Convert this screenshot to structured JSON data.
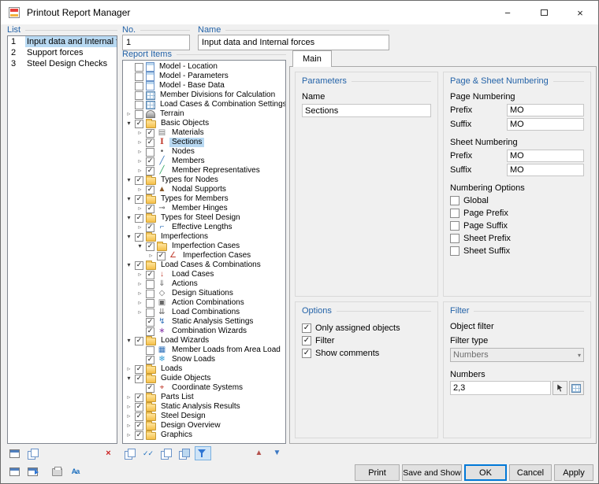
{
  "window": {
    "title": "Printout Report Manager",
    "minimize_glyph": "−",
    "close_glyph": "×"
  },
  "left": {
    "list_label": "List",
    "items": [
      {
        "no": "1",
        "label": "Input data and Internal forces",
        "selected": true
      },
      {
        "no": "2",
        "label": "Support forces",
        "selected": false
      },
      {
        "no": "3",
        "label": "Steel Design Checks",
        "selected": false
      }
    ]
  },
  "fields": {
    "no_label": "No.",
    "no_value": "1",
    "name_label": "Name",
    "name_value": "Input data and Internal forces"
  },
  "tree": {
    "label": "Report Items",
    "items": [
      {
        "lvl": 0,
        "arrow": "",
        "chk": false,
        "icon": "model",
        "label": "Model - Location",
        "sel": false
      },
      {
        "lvl": 0,
        "arrow": "",
        "chk": false,
        "icon": "model",
        "label": "Model - Parameters",
        "sel": false
      },
      {
        "lvl": 0,
        "arrow": "",
        "chk": false,
        "icon": "model",
        "label": "Model - Base Data",
        "sel": false
      },
      {
        "lvl": 0,
        "arrow": "",
        "chk": false,
        "icon": "grid",
        "label": "Member Divisions for Calculation",
        "sel": false
      },
      {
        "lvl": 0,
        "arrow": "",
        "chk": false,
        "icon": "grid",
        "label": "Load Cases & Combination Settings",
        "sel": false
      },
      {
        "lvl": 0,
        "arrow": "c",
        "chk": false,
        "icon": "terrain",
        "label": "Terrain",
        "sel": false
      },
      {
        "lvl": 0,
        "arrow": "e",
        "chk": true,
        "icon": "folder",
        "label": "Basic Objects",
        "sel": false
      },
      {
        "lvl": 1,
        "arrow": "c",
        "chk": true,
        "icon": "materials",
        "label": "Materials",
        "sel": false
      },
      {
        "lvl": 1,
        "arrow": "c",
        "chk": true,
        "icon": "sections",
        "label": "Sections",
        "sel": true
      },
      {
        "lvl": 1,
        "arrow": "c",
        "chk": false,
        "icon": "nodes",
        "label": "Nodes",
        "sel": false
      },
      {
        "lvl": 1,
        "arrow": "c",
        "chk": true,
        "icon": "members",
        "label": "Members",
        "sel": false
      },
      {
        "lvl": 1,
        "arrow": "c",
        "chk": true,
        "icon": "member-representatives",
        "label": "Member Representatives",
        "sel": false
      },
      {
        "lvl": 0,
        "arrow": "e",
        "chk": true,
        "icon": "folder",
        "label": "Types for Nodes",
        "sel": false
      },
      {
        "lvl": 1,
        "arrow": "c",
        "chk": true,
        "icon": "nodal-supports",
        "label": "Nodal Supports",
        "sel": false
      },
      {
        "lvl": 0,
        "arrow": "e",
        "chk": true,
        "icon": "folder",
        "label": "Types for Members",
        "sel": false
      },
      {
        "lvl": 1,
        "arrow": "c",
        "chk": true,
        "icon": "member-hinges",
        "label": "Member Hinges",
        "sel": false
      },
      {
        "lvl": 0,
        "arrow": "e",
        "chk": true,
        "icon": "folder",
        "label": "Types for Steel Design",
        "sel": false
      },
      {
        "lvl": 1,
        "arrow": "c",
        "chk": true,
        "icon": "effective-lengths",
        "label": "Effective Lengths",
        "sel": false
      },
      {
        "lvl": 0,
        "arrow": "e",
        "chk": true,
        "icon": "folder",
        "label": "Imperfections",
        "sel": false
      },
      {
        "lvl": 1,
        "arrow": "e",
        "chk": true,
        "icon": "folder",
        "label": "Imperfection Cases",
        "sel": false
      },
      {
        "lvl": 2,
        "arrow": "c",
        "chk": true,
        "icon": "imperfection-case",
        "label": "Imperfection Cases",
        "sel": false
      },
      {
        "lvl": 0,
        "arrow": "e",
        "chk": true,
        "icon": "folder",
        "label": "Load Cases & Combinations",
        "sel": false
      },
      {
        "lvl": 1,
        "arrow": "c",
        "chk": true,
        "icon": "load-cases",
        "label": "Load Cases",
        "sel": false
      },
      {
        "lvl": 1,
        "arrow": "c",
        "chk": false,
        "icon": "actions",
        "label": "Actions",
        "sel": false
      },
      {
        "lvl": 1,
        "arrow": "c",
        "chk": false,
        "icon": "design-situations",
        "label": "Design Situations",
        "sel": false
      },
      {
        "lvl": 1,
        "arrow": "c",
        "chk": false,
        "icon": "action-combinations",
        "label": "Action Combinations",
        "sel": false
      },
      {
        "lvl": 1,
        "arrow": "c",
        "chk": false,
        "icon": "load-combinations",
        "label": "Load Combinations",
        "sel": false
      },
      {
        "lvl": 1,
        "arrow": "",
        "chk": true,
        "icon": "static-analysis-settings",
        "label": "Static Analysis Settings",
        "sel": false
      },
      {
        "lvl": 1,
        "arrow": "",
        "chk": true,
        "icon": "combination-wizards",
        "label": "Combination Wizards",
        "sel": false
      },
      {
        "lvl": 0,
        "arrow": "e",
        "chk": true,
        "icon": "folder",
        "label": "Load Wizards",
        "sel": false
      },
      {
        "lvl": 1,
        "arrow": "",
        "chk": false,
        "icon": "area-load",
        "label": "Member Loads from Area Load",
        "sel": false
      },
      {
        "lvl": 1,
        "arrow": "",
        "chk": true,
        "icon": "snow-loads",
        "label": "Snow Loads",
        "sel": false
      },
      {
        "lvl": 0,
        "arrow": "c",
        "chk": true,
        "icon": "folder",
        "label": "Loads",
        "sel": false
      },
      {
        "lvl": 0,
        "arrow": "e",
        "chk": true,
        "icon": "folder",
        "label": "Guide Objects",
        "sel": false
      },
      {
        "lvl": 1,
        "arrow": "",
        "chk": true,
        "icon": "coordinate-systems",
        "label": "Coordinate Systems",
        "sel": false
      },
      {
        "lvl": 0,
        "arrow": "c",
        "chk": true,
        "icon": "folder",
        "label": "Parts List",
        "sel": false
      },
      {
        "lvl": 0,
        "arrow": "c",
        "chk": true,
        "icon": "folder",
        "label": "Static Analysis Results",
        "sel": false
      },
      {
        "lvl": 0,
        "arrow": "c",
        "chk": true,
        "icon": "folder",
        "label": "Steel Design",
        "sel": false
      },
      {
        "lvl": 0,
        "arrow": "c",
        "chk": true,
        "icon": "folder",
        "label": "Design Overview",
        "sel": false
      },
      {
        "lvl": 0,
        "arrow": "c",
        "chk": true,
        "icon": "folder",
        "label": "Graphics",
        "sel": false
      }
    ]
  },
  "tabs": {
    "main_label": "Main"
  },
  "parameters": {
    "title": "Parameters",
    "name_label": "Name",
    "name_value": "Sections"
  },
  "numbering": {
    "title": "Page & Sheet Numbering",
    "page_label": "Page Numbering",
    "sheet_label": "Sheet Numbering",
    "prefix_label": "Prefix",
    "suffix_label": "Suffix",
    "page_prefix": "MO",
    "page_suffix": "MO",
    "sheet_prefix": "MO",
    "sheet_suffix": "MO",
    "options_label": "Numbering Options",
    "options": [
      {
        "label": "Global",
        "checked": false
      },
      {
        "label": "Page Prefix",
        "checked": false
      },
      {
        "label": "Page Suffix",
        "checked": false
      },
      {
        "label": "Sheet Prefix",
        "checked": false
      },
      {
        "label": "Sheet Suffix",
        "checked": false
      }
    ]
  },
  "options": {
    "title": "Options",
    "items": [
      {
        "label": "Only assigned objects",
        "checked": true
      },
      {
        "label": "Filter",
        "checked": true
      },
      {
        "label": "Show comments",
        "checked": true
      }
    ]
  },
  "filter": {
    "title": "Filter",
    "object_filter_label": "Object filter",
    "type_label": "Filter type",
    "type_value": "Numbers",
    "numbers_label": "Numbers",
    "numbers_value": "2,3"
  },
  "footer": {
    "print": "Print",
    "save_and_show": "Save and Show",
    "ok": "OK",
    "cancel": "Cancel",
    "apply": "Apply"
  },
  "toolbars": {
    "list": [
      {
        "name": "new-report",
        "icon": "win"
      },
      {
        "name": "copy-report",
        "icon": "docs"
      },
      {
        "name": "delete-report",
        "icon": "delete-x"
      }
    ],
    "tree": [
      {
        "name": "cascade-items",
        "icon": "docs"
      },
      {
        "name": "check-subitems",
        "icon": "double-check"
      },
      {
        "name": "copy-item",
        "icon": "docs"
      },
      {
        "name": "paste-item",
        "icon": "docs-blue"
      },
      {
        "name": "filter-display",
        "icon": "funnel",
        "pressed": true
      },
      {
        "name": "move-up",
        "icon": "arrow-up"
      },
      {
        "name": "move-down",
        "icon": "arrow-down"
      }
    ],
    "footer": [
      {
        "name": "report-header-settings",
        "icon": "win"
      },
      {
        "name": "open-report-viewer",
        "icon": "win-arrow"
      },
      {
        "name": "printer-setup",
        "icon": "printer"
      },
      {
        "name": "language-settings",
        "icon": "fonts"
      }
    ]
  },
  "icons": {
    "model": {
      "css": "doc"
    },
    "grid": {
      "css": "grid"
    },
    "terrain": {
      "css": "terrain"
    },
    "folder": {
      "css": "folder"
    },
    "materials": {
      "glyph": "▤",
      "color": "#7d7d7d"
    },
    "sections": {
      "glyph": "I",
      "color": "#c03a2b",
      "serif": true
    },
    "nodes": {
      "glyph": "•",
      "color": "#555555"
    },
    "members": {
      "glyph": "╱",
      "color": "#2e6fb8"
    },
    "member-representatives": {
      "glyph": "╱",
      "color": "#27a05d"
    },
    "nodal-supports": {
      "glyph": "▲",
      "color": "#8b5a2b"
    },
    "member-hinges": {
      "glyph": "⊸",
      "color": "#555555"
    },
    "effective-lengths": {
      "glyph": "⌐",
      "color": "#2e6fb8"
    },
    "imperfection-case": {
      "glyph": "∠",
      "color": "#c03a2b"
    },
    "load-cases": {
      "glyph": "↓",
      "color": "#c03a2b"
    },
    "actions": {
      "glyph": "⇓",
      "color": "#666666"
    },
    "design-situations": {
      "glyph": "◇",
      "color": "#666666"
    },
    "action-combinations": {
      "glyph": "▣",
      "color": "#666666"
    },
    "load-combinations": {
      "glyph": "⇊",
      "color": "#666666"
    },
    "static-analysis-settings": {
      "glyph": "↯",
      "color": "#2e6fb8"
    },
    "combination-wizards": {
      "glyph": "∗",
      "color": "#8e44ad"
    },
    "area-load": {
      "glyph": "▦",
      "color": "#2e6fb8"
    },
    "snow-loads": {
      "glyph": "❄",
      "color": "#2e9bd6"
    },
    "coordinate-systems": {
      "glyph": "⌖",
      "color": "#c03a2b"
    },
    "delete-x": {
      "glyph": "×",
      "color": "#cc2222",
      "bold": true
    },
    "double-check": {
      "glyph": "✓✓",
      "color": "#1d6fbe"
    },
    "arrow-up": {
      "glyph": "▲",
      "color": "#b4524d"
    },
    "arrow-down": {
      "glyph": "▼",
      "color": "#3b78c3"
    },
    "fonts": {
      "glyph": "Aa",
      "color": "#1d6fbe",
      "bold": true
    },
    "win": {
      "css": "win"
    },
    "win-arrow": {
      "css": "win-arrow"
    },
    "printer": {
      "css": "printer"
    },
    "docs": {
      "css": "docs"
    },
    "docs-blue": {
      "css": "docs-blue"
    },
    "funnel": {
      "css": "funnel"
    }
  }
}
